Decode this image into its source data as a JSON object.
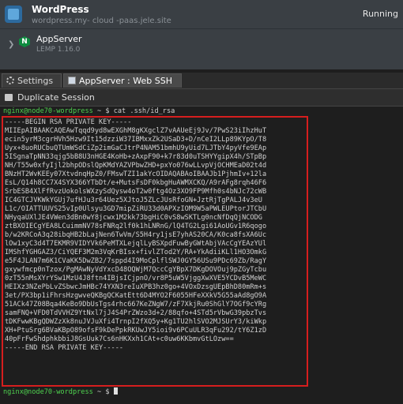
{
  "env": {
    "name": "WordPress",
    "url": "wordpress.my- cloud -paas.jele.site",
    "status": "Running",
    "node": {
      "name": "AppServer",
      "version": "LEMP 1.16.0"
    }
  },
  "tabs": [
    {
      "label": "Settings",
      "icon": "gear-icon"
    },
    {
      "label": "AppServer : Web SSH",
      "icon": "terminal-icon"
    }
  ],
  "toolbar": {
    "duplicate_label": "Duplicate Session"
  },
  "terminal": {
    "prompt_user": "nginx@node70-wordpress",
    "prompt_path": " ~ $ ",
    "command": "cat .ssh/id_rsa",
    "key_lines": [
      "-----BEGIN RSA PRIVATE KEY-----",
      "MIIEpAIBAAKCAQEAwTqqd9yd8wEXGhM8gKXgclZ7vAAUeEj9Jv/7PwS23iIhzHuT",
      "ecin5yrM3cgrHVh5Hzw9It15dzziW37IBMxxZk2USaD3+D/nCeI2LLp89KYpO/T8",
      "Uyx+8uoRUCbuQTUmWSdCiZp2imGaCJtrP4NAM51bmhU9yUid7LJTbY4pyVfe9EAp",
      "5ISgnaTpNN33qjg5bB8U3nHGE4KoHb+zAxpF90+k7r83d0uTSHYYgipX4h/STpBp",
      "NH/T55w0xfyIjl2bhpODslQpKMdYAZVPbwZHD+pxYo076wLLvpVjOCHMEaD02t4d",
      "BNzHT2WvKEEy07XtvdnqHpZ0/FMswTZI1akYcOIDAQABAoIBAAJb1PjhmIv+12la",
      "EsL/Q14h8CC7X4SYX366YTbDt/e+MutsFsDF0kbgHuAWMXCKQ/A9rAFg8rqh46F6",
      "SrbESB4XlFfRvzUokolsWXzySdQysw4oT2w0ftg4Oz3XO9FP9Mfh0s4bNJc72cWB",
      "IC4GTCJVKWkYGUj7ufHJu3r64Uez5XJtoJ5ZLcJUsRfoGN+JztRjTgPALJ4v3eU",
      "L1c/OIATTUUVS25vIp0Ulsyu3GD7mipZiRU33d0APXzIOM9W5aPWLEUPtorJTCbU",
      "NHyqaUXlJE4VWen3dBn0wY8jcwx1M2kk73bgHiC0vS8wSKTLg0ncNfDqQjNCODG",
      "ztBXOIECgYEA8LCuimmNV78sFNRq2lf0k1hLNRnG/lQ4TG2Lgi61AoUGv1R6qogo",
      "b/w2KRCoA3q28ibqHB2bLajNen6TwVm/S5H4ry1jsE7yhAS20CA/K0ca8fsXA6Uc",
      "lOw1xyC3d4T7EKMR9VIDYVk6PeMTXLejqlLyBSXpdFuwByGWtAbjVAcCgYEAzYUl",
      "IMShfYGHGAZ3/CiYQEF3M2m3VqKrBIsx+fivlZTod2Y/RA+YkAdiiKLl1HO3OmkG",
      "e5F4JLAN7m6K1CVaKK5DwZB2/7sppd4I9MoCplflSWJ0GY56USu9PDc69Zb/RagY",
      "gxywfmcp0nTzox/PgMAwNyVdYxcD48OQWjM7QccCgYBpX7DKgDOVOuj9pZGyTcbu",
      "0zT55nMsXYrYSw1MzU4J8ftn4IBjsICjpnO/vr8P5uW5VjggXwXVE5YCDvB5MeWC",
      "HEIXz3NZePbLvZSbwcJmHBc74YXN3reIuXPB3hz0go+4VOxDzsgUEpBhD80mRm+s",
      "3et/PX3bp1iFhrsHzgwveQKBgQCKatEtt6D4MYO2F6055HFeXXkV5G55aAd8gO9A",
      "51ACk47Z08Bqa4KeBo9DbUsTgs4rhc667KeZNgW7/zF7XkjRu0ShGlY7OGf9cYRg",
      "samFNQ+VFD0TdVVHZ9YtNxl7jJ4S4PrZWzo3d+2/88qfo+4STd5rVbwG39pbzTvs",
      "tDKFwwKBgQDWZzXk8nuJVJuXfi4TrnpI2fXQ5y+Kg1TU2hlSVO2MJSUrY3/kiWkp",
      "XH+PtuSrg6BVaKBpO89ofsF9kDePpkRKUwJY5ioi9v6PCuULR3qFu292/tY6Z1zD",
      "40pFrFwShdphkbbiJ8GsUuk7Cs6nHKXxh1CAt+c0uw6KKbmvGtLOzw==",
      "-----END RSA PRIVATE KEY-----"
    ]
  }
}
